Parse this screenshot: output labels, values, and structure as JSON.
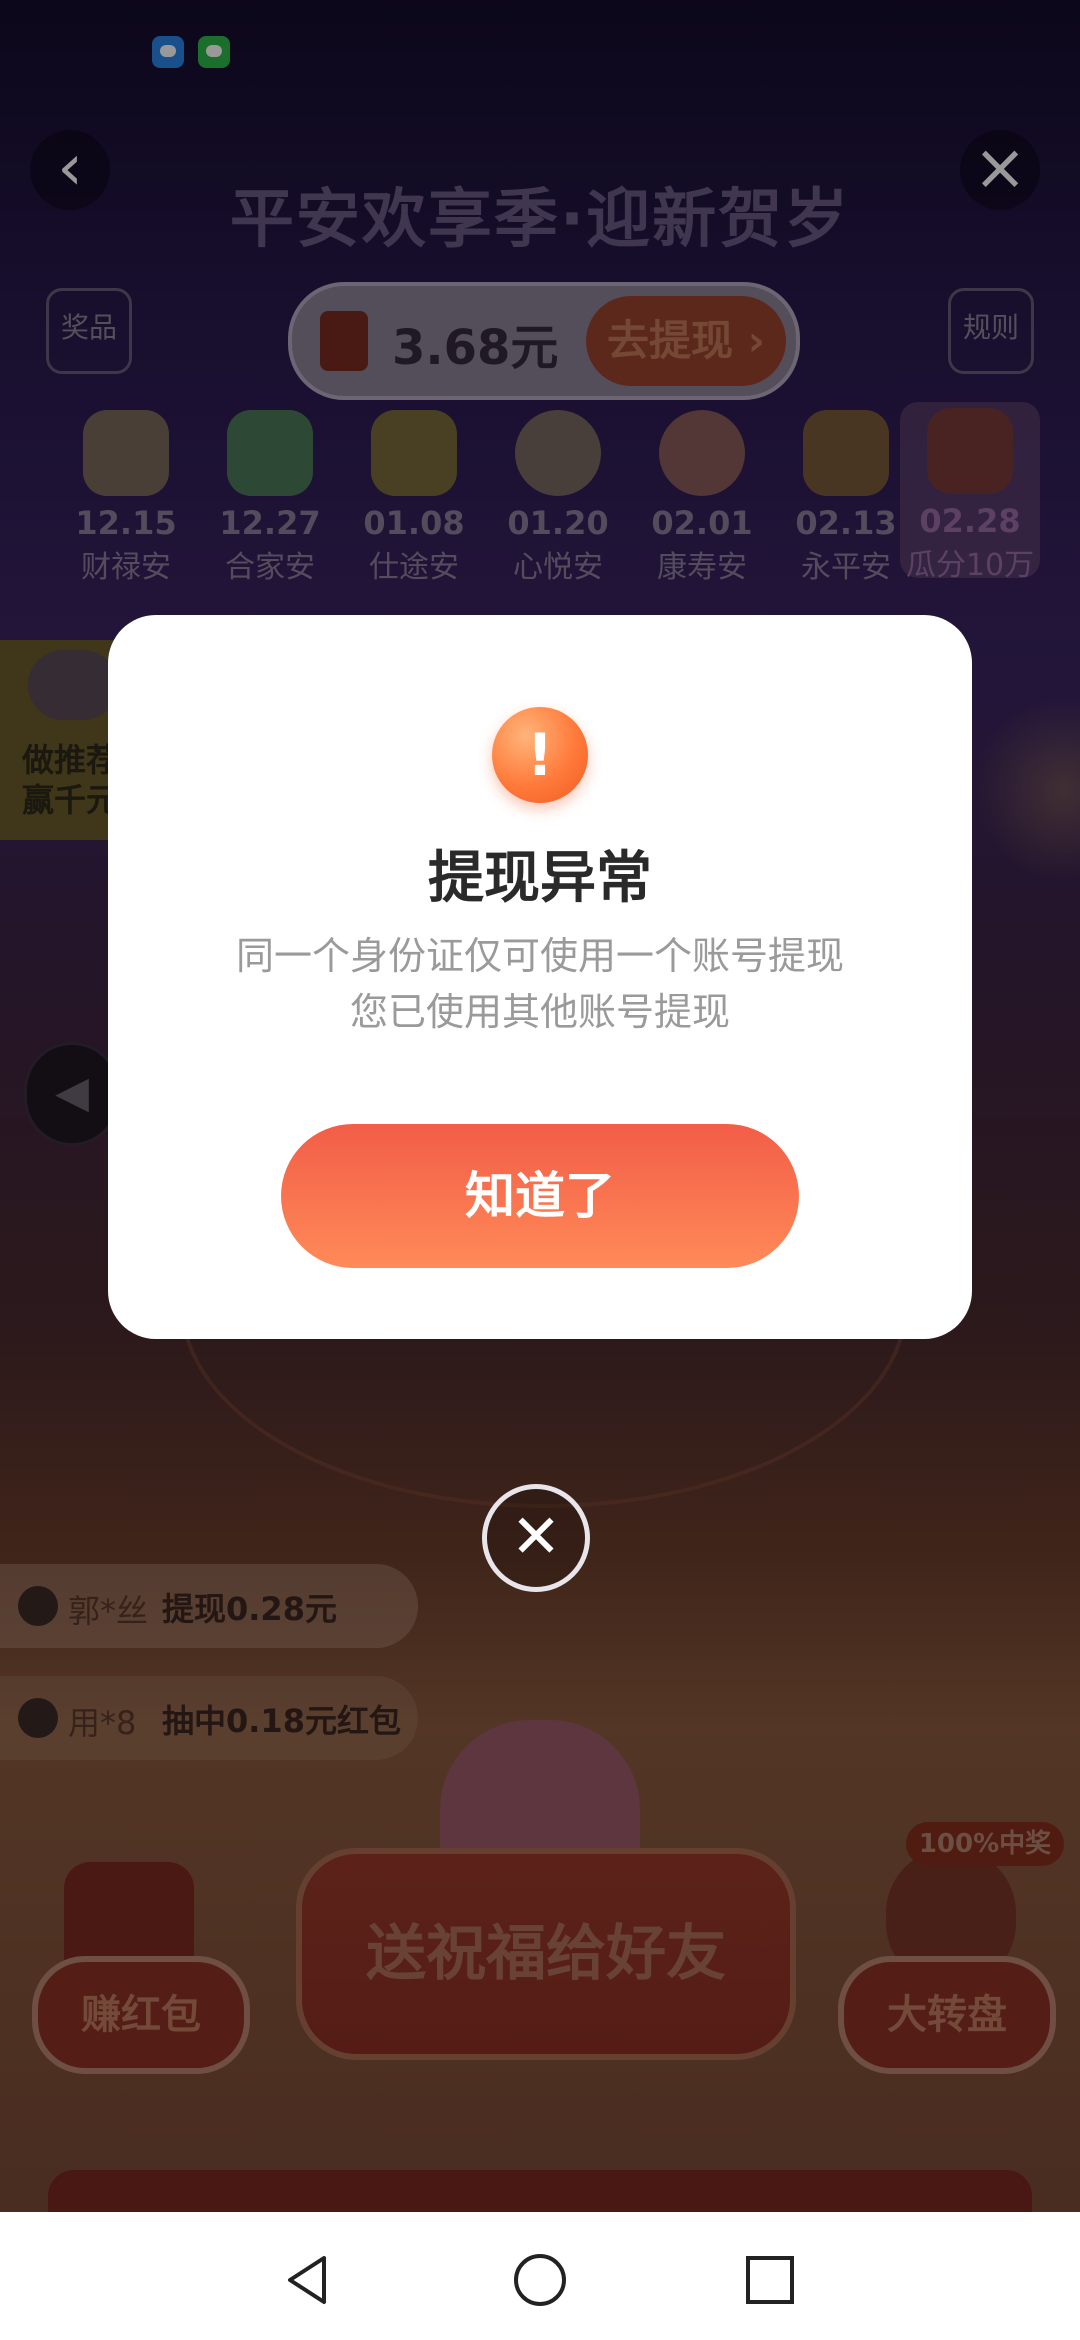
{
  "status_bar": {
    "icons": [
      "message-app-icon",
      "wechat-icon"
    ]
  },
  "header": {
    "title": "平安欢享季·迎新贺岁",
    "back_icon": "chevron-left-icon",
    "close_icon": "close-icon",
    "prize_label": "奖品",
    "rules_label": "规则"
  },
  "balance": {
    "amount": "3.68元",
    "withdraw_label": "去提现 ›"
  },
  "milestones": [
    {
      "date": "12.15",
      "name": "财禄安"
    },
    {
      "date": "12.27",
      "name": "合家安"
    },
    {
      "date": "01.08",
      "name": "仕途安"
    },
    {
      "date": "01.20",
      "name": "心悦安"
    },
    {
      "date": "02.01",
      "name": "康寿安"
    },
    {
      "date": "02.13",
      "name": "永平安"
    },
    {
      "date": "02.28",
      "name": "瓜分10万"
    }
  ],
  "recommend": {
    "line1": "做推荐",
    "line2": "赢千元"
  },
  "tickers": [
    {
      "user": "郭*丝",
      "text": "提现0.28元"
    },
    {
      "user": "用*8",
      "text": "抽中0.18元红包"
    }
  ],
  "actions": {
    "main_cta": "送祝福给好友",
    "earn_red_packet": "赚红包",
    "wheel": "大转盘",
    "win_badge": "100%中奖"
  },
  "dialog": {
    "icon": "exclamation-icon",
    "title": "提现异常",
    "message_line1": "同一个身份证仅可使用一个账号提现",
    "message_line2": "您已使用其他账号提现",
    "button": "知道了",
    "close_icon": "close-circle-icon"
  },
  "nav": {
    "back": "nav-back-icon",
    "home": "nav-home-icon",
    "recent": "nav-recent-icon"
  },
  "colors": {
    "primary_button": "#f25d47",
    "warning_icon": "#ff7a3a",
    "dialog_title": "#2a2a2a",
    "dialog_message": "#9a9a9a"
  }
}
